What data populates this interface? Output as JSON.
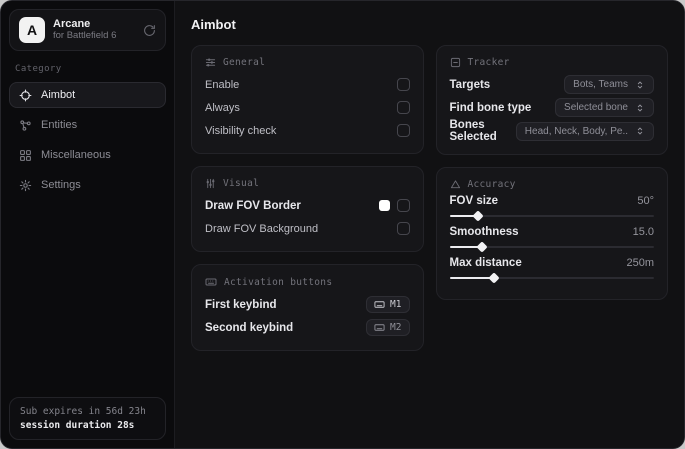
{
  "colors": {
    "window_bg": "#0e0e10",
    "sidebar_bg": "#0b0b0d",
    "card_bg": "#161619",
    "accent_text": "#ececf0",
    "muted_text": "#8d8d95",
    "fov_border_swatch": "#ffffff"
  },
  "sidebar": {
    "brand": {
      "initial": "A",
      "name": "Arcane",
      "subtitle": "for Battlefield 6"
    },
    "category_label": "Category",
    "items": [
      {
        "label": "Aimbot",
        "active": true
      },
      {
        "label": "Entities",
        "active": false
      },
      {
        "label": "Miscellaneous",
        "active": false
      },
      {
        "label": "Settings",
        "active": false
      }
    ],
    "subscription": {
      "expires": "Sub expires in 56d 23h",
      "session": "session duration 28s"
    }
  },
  "main": {
    "title": "Aimbot",
    "general": {
      "title": "General",
      "rows": [
        {
          "label": "Enable",
          "checked": false
        },
        {
          "label": "Always",
          "checked": false
        },
        {
          "label": "Visibility check",
          "checked": false
        }
      ]
    },
    "visual": {
      "title": "Visual",
      "rows": [
        {
          "label": "Draw FOV Border",
          "swatch": "#ffffff",
          "checked": false
        },
        {
          "label": "Draw FOV Background",
          "checked": false
        }
      ]
    },
    "activation": {
      "title": "Activation buttons",
      "rows": [
        {
          "label": "First keybind",
          "key": "M1"
        },
        {
          "label": "Second keybind",
          "key": "M2"
        }
      ]
    },
    "tracker": {
      "title": "Tracker",
      "rows": [
        {
          "label": "Targets",
          "value": "Bots, Teams"
        },
        {
          "label": "Find bone type",
          "value": "Selected bone"
        },
        {
          "label": "Bones Selected",
          "value": "Head, Neck, Body, Pe.."
        }
      ]
    },
    "accuracy": {
      "title": "Accuracy",
      "sliders": [
        {
          "label": "FOV size",
          "value": "50°",
          "percent": 14
        },
        {
          "label": "Smoothness",
          "value": "15.0",
          "percent": 16
        },
        {
          "label": "Max distance",
          "value": "250m",
          "percent": 22
        }
      ]
    }
  }
}
